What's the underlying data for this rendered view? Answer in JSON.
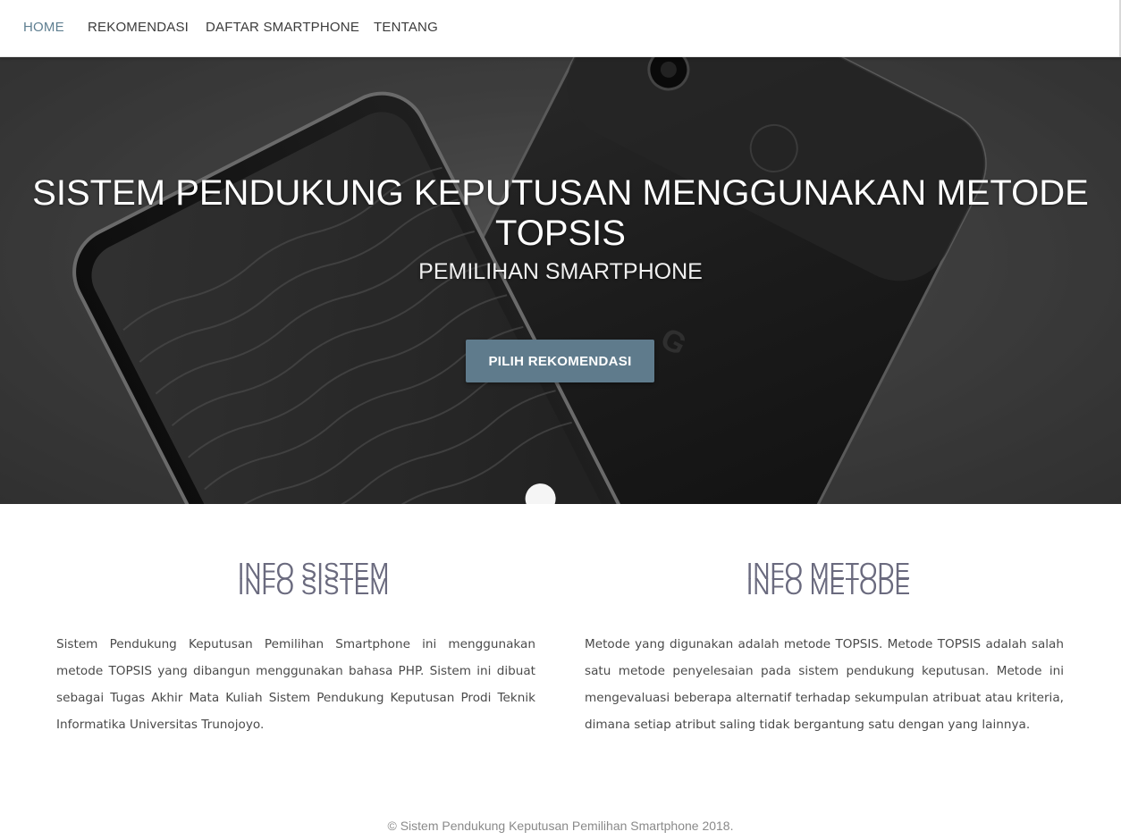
{
  "nav": {
    "items": [
      {
        "label": "HOME",
        "active": true
      },
      {
        "label": "REKOMENDASI",
        "active": false
      },
      {
        "label": "DAFTAR SMARTPHONE",
        "active": false
      },
      {
        "label": "TENTANG",
        "active": false
      }
    ]
  },
  "hero": {
    "title_line1": "SISTEM PENDUKUNG KEPUTUSAN MENGGUNAKAN METODE",
    "title_line2": "TOPSIS",
    "subtitle": "PEMILIHAN SMARTPHONE",
    "button_label": "PILIH REKOMENDASI"
  },
  "info_sistem": {
    "title": "INFO SISTEM",
    "text": "Sistem Pendukung Keputusan Pemilihan Smartphone ini menggunakan metode TOPSIS yang dibangun menggunakan bahasa PHP. Sistem ini dibuat sebagai Tugas Akhir Mata Kuliah Sistem Pendukung Keputusan Prodi Teknik Informatika Universitas Trunojoyo."
  },
  "info_metode": {
    "title": "INFO METODE",
    "text": "Metode yang digunakan adalah metode TOPSIS. Metode TOPSIS adalah salah satu metode penyelesaian pada sistem pendukung keputusan. Metode ini mengevaluasi beberapa alternatif terhadap sekumpulan atribuat atau kriteria, dimana setiap atribut saling tidak bergantung satu dengan yang lainnya."
  },
  "footer": {
    "text": "© Sistem Pendukung Keputusan Pemilihan Smartphone 2018."
  },
  "colors": {
    "accent": "#5f7b8c",
    "nav_active": "#5f7f91",
    "heading": "#6a6a7e"
  }
}
